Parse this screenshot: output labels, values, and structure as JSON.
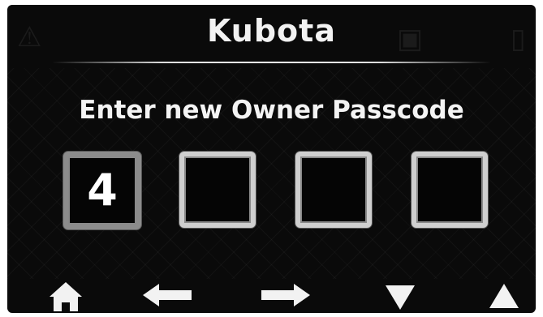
{
  "brand": {
    "name": "Kubota"
  },
  "screen": {
    "title": "Enter new Owner Passcode"
  },
  "passcode": {
    "digits": [
      "4",
      "",
      "",
      ""
    ],
    "active_index": 0
  },
  "nav": {
    "home": {
      "icon": "home-icon"
    },
    "back": {
      "icon": "arrow-left-icon"
    },
    "forward": {
      "icon": "arrow-right-icon"
    },
    "down": {
      "icon": "triangle-down-icon"
    },
    "up": {
      "icon": "triangle-up-icon"
    }
  },
  "colors": {
    "background": "#0a0a0a",
    "text": "#f4f4f4",
    "box_border": "#cfcfcf",
    "active_box_border": "#8c8c8c"
  }
}
